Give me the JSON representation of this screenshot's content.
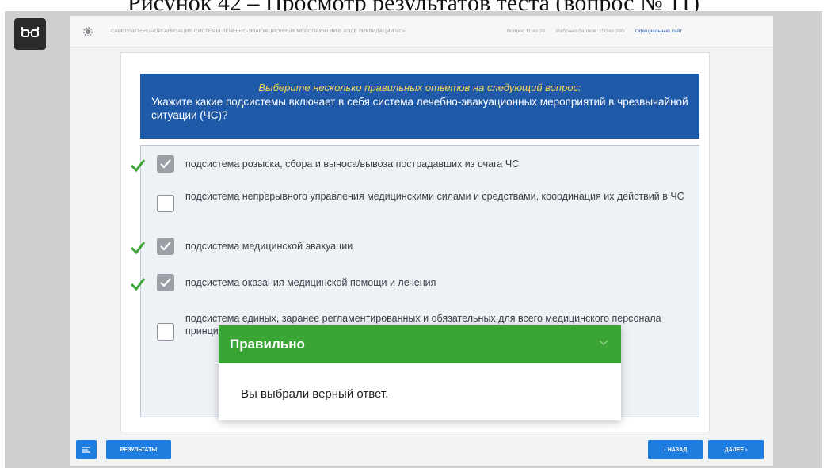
{
  "caption": "Рисунок 42 – Просмотр результатов теста (вопрос № 11)",
  "header": {
    "title": "САМОУЧИТЕЛЬ «ОРГАНИЗАЦИЯ СИСТЕМЫ ЛЕЧЕБНО-ЭВАКУАЦИОННЫХ МЕРОПРИЯТИЙ В ХОДЕ ЛИКВИДАЦИИ ЧС»",
    "question_counter": "Вопрос 11 из 20",
    "score": "Набрано баллов: 150 из 200",
    "site_link": "Официальный сайт"
  },
  "question": {
    "hint": "Выберите несколько правильных ответов на следующий вопрос:",
    "text": "Укажите какие подсистемы включает в себя система лечебно-эвакуационных мероприятий в чрезвычайной ситуации (ЧС)?"
  },
  "answers": [
    {
      "text": "подсистема розыска, сбора и выноса/вывоза пострадавших из очага ЧС",
      "checked": true,
      "correct": true
    },
    {
      "text": "подсистема непрерывного управления медицинскими силами и средствами, координация их действий в ЧС",
      "checked": false,
      "correct": false
    },
    {
      "text": "подсистема медицинской эвакуации",
      "checked": true,
      "correct": true
    },
    {
      "text": "подсистема оказания медицинской помощи и лечения",
      "checked": true,
      "correct": true
    },
    {
      "text": "подсистема единых, заранее регламентированных и обязательных для всего медицинского персонала принципов оказания медицинской помощи и лечения поражённых",
      "checked": false,
      "correct": false
    }
  ],
  "toast": {
    "title": "Правильно",
    "message": "Вы выбрали верный ответ."
  },
  "footer": {
    "results_label": "РЕЗУЛЬТАТЫ",
    "back_label": "‹ НАЗАД",
    "next_label": "ДАЛЕЕ ›"
  },
  "colors": {
    "question_bg": "#1f5aa8",
    "hint": "#f4d35e",
    "toast_header": "#3aa535",
    "check_mark": "#3aa535",
    "button": "#1f7de0"
  }
}
